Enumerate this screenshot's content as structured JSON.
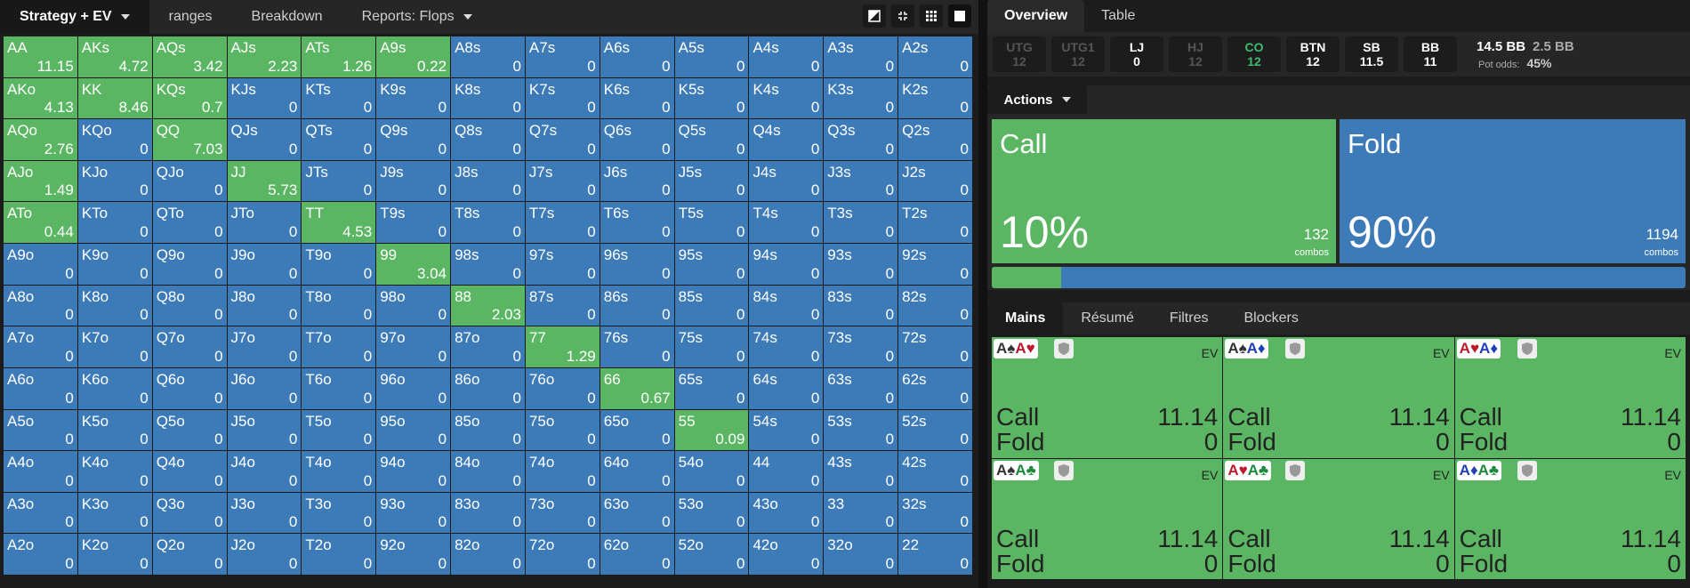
{
  "left_tabs": [
    {
      "label": "Strategy + EV",
      "dropdown": true,
      "active": true
    },
    {
      "label": "ranges"
    },
    {
      "label": "Breakdown"
    },
    {
      "label": "Reports: Flops",
      "dropdown": true
    }
  ],
  "view_buttons": [
    "contrast-icon",
    "compress-icon",
    "grid-icon",
    "square-icon"
  ],
  "grid": [
    [
      [
        "AA",
        "11.15",
        1
      ],
      [
        "AKs",
        "4.72",
        1
      ],
      [
        "AQs",
        "3.42",
        1
      ],
      [
        "AJs",
        "2.23",
        1
      ],
      [
        "ATs",
        "1.26",
        1
      ],
      [
        "A9s",
        "0.22",
        1
      ],
      [
        "A8s",
        "0",
        0
      ],
      [
        "A7s",
        "0",
        0
      ],
      [
        "A6s",
        "0",
        0
      ],
      [
        "A5s",
        "0",
        0
      ],
      [
        "A4s",
        "0",
        0
      ],
      [
        "A3s",
        "0",
        0
      ],
      [
        "A2s",
        "0",
        0
      ]
    ],
    [
      [
        "AKo",
        "4.13",
        1
      ],
      [
        "KK",
        "8.46",
        1
      ],
      [
        "KQs",
        "0.7",
        1
      ],
      [
        "KJs",
        "0",
        0
      ],
      [
        "KTs",
        "0",
        0
      ],
      [
        "K9s",
        "0",
        0
      ],
      [
        "K8s",
        "0",
        0
      ],
      [
        "K7s",
        "0",
        0
      ],
      [
        "K6s",
        "0",
        0
      ],
      [
        "K5s",
        "0",
        0
      ],
      [
        "K4s",
        "0",
        0
      ],
      [
        "K3s",
        "0",
        0
      ],
      [
        "K2s",
        "0",
        0
      ]
    ],
    [
      [
        "AQo",
        "2.76",
        1
      ],
      [
        "KQo",
        "0",
        0
      ],
      [
        "QQ",
        "7.03",
        1
      ],
      [
        "QJs",
        "0",
        0
      ],
      [
        "QTs",
        "0",
        0
      ],
      [
        "Q9s",
        "0",
        0
      ],
      [
        "Q8s",
        "0",
        0
      ],
      [
        "Q7s",
        "0",
        0
      ],
      [
        "Q6s",
        "0",
        0
      ],
      [
        "Q5s",
        "0",
        0
      ],
      [
        "Q4s",
        "0",
        0
      ],
      [
        "Q3s",
        "0",
        0
      ],
      [
        "Q2s",
        "0",
        0
      ]
    ],
    [
      [
        "AJo",
        "1.49",
        1
      ],
      [
        "KJo",
        "0",
        0
      ],
      [
        "QJo",
        "0",
        0
      ],
      [
        "JJ",
        "5.73",
        1
      ],
      [
        "JTs",
        "0",
        0
      ],
      [
        "J9s",
        "0",
        0
      ],
      [
        "J8s",
        "0",
        0
      ],
      [
        "J7s",
        "0",
        0
      ],
      [
        "J6s",
        "0",
        0
      ],
      [
        "J5s",
        "0",
        0
      ],
      [
        "J4s",
        "0",
        0
      ],
      [
        "J3s",
        "0",
        0
      ],
      [
        "J2s",
        "0",
        0
      ]
    ],
    [
      [
        "ATo",
        "0.44",
        1
      ],
      [
        "KTo",
        "0",
        0
      ],
      [
        "QTo",
        "0",
        0
      ],
      [
        "JTo",
        "0",
        0
      ],
      [
        "TT",
        "4.53",
        1
      ],
      [
        "T9s",
        "0",
        0
      ],
      [
        "T8s",
        "0",
        0
      ],
      [
        "T7s",
        "0",
        0
      ],
      [
        "T6s",
        "0",
        0
      ],
      [
        "T5s",
        "0",
        0
      ],
      [
        "T4s",
        "0",
        0
      ],
      [
        "T3s",
        "0",
        0
      ],
      [
        "T2s",
        "0",
        0
      ]
    ],
    [
      [
        "A9o",
        "0",
        0
      ],
      [
        "K9o",
        "0",
        0
      ],
      [
        "Q9o",
        "0",
        0
      ],
      [
        "J9o",
        "0",
        0
      ],
      [
        "T9o",
        "0",
        0
      ],
      [
        "99",
        "3.04",
        1
      ],
      [
        "98s",
        "0",
        0
      ],
      [
        "97s",
        "0",
        0
      ],
      [
        "96s",
        "0",
        0
      ],
      [
        "95s",
        "0",
        0
      ],
      [
        "94s",
        "0",
        0
      ],
      [
        "93s",
        "0",
        0
      ],
      [
        "92s",
        "0",
        0
      ]
    ],
    [
      [
        "A8o",
        "0",
        0
      ],
      [
        "K8o",
        "0",
        0
      ],
      [
        "Q8o",
        "0",
        0
      ],
      [
        "J8o",
        "0",
        0
      ],
      [
        "T8o",
        "0",
        0
      ],
      [
        "98o",
        "0",
        0
      ],
      [
        "88",
        "2.03",
        1
      ],
      [
        "87s",
        "0",
        0
      ],
      [
        "86s",
        "0",
        0
      ],
      [
        "85s",
        "0",
        0
      ],
      [
        "84s",
        "0",
        0
      ],
      [
        "83s",
        "0",
        0
      ],
      [
        "82s",
        "0",
        0
      ]
    ],
    [
      [
        "A7o",
        "0",
        0
      ],
      [
        "K7o",
        "0",
        0
      ],
      [
        "Q7o",
        "0",
        0
      ],
      [
        "J7o",
        "0",
        0
      ],
      [
        "T7o",
        "0",
        0
      ],
      [
        "97o",
        "0",
        0
      ],
      [
        "87o",
        "0",
        0
      ],
      [
        "77",
        "1.29",
        1
      ],
      [
        "76s",
        "0",
        0
      ],
      [
        "75s",
        "0",
        0
      ],
      [
        "74s",
        "0",
        0
      ],
      [
        "73s",
        "0",
        0
      ],
      [
        "72s",
        "0",
        0
      ]
    ],
    [
      [
        "A6o",
        "0",
        0
      ],
      [
        "K6o",
        "0",
        0
      ],
      [
        "Q6o",
        "0",
        0
      ],
      [
        "J6o",
        "0",
        0
      ],
      [
        "T6o",
        "0",
        0
      ],
      [
        "96o",
        "0",
        0
      ],
      [
        "86o",
        "0",
        0
      ],
      [
        "76o",
        "0",
        0
      ],
      [
        "66",
        "0.67",
        1
      ],
      [
        "65s",
        "0",
        0
      ],
      [
        "64s",
        "0",
        0
      ],
      [
        "63s",
        "0",
        0
      ],
      [
        "62s",
        "0",
        0
      ]
    ],
    [
      [
        "A5o",
        "0",
        0
      ],
      [
        "K5o",
        "0",
        0
      ],
      [
        "Q5o",
        "0",
        0
      ],
      [
        "J5o",
        "0",
        0
      ],
      [
        "T5o",
        "0",
        0
      ],
      [
        "95o",
        "0",
        0
      ],
      [
        "85o",
        "0",
        0
      ],
      [
        "75o",
        "0",
        0
      ],
      [
        "65o",
        "0",
        0
      ],
      [
        "55",
        "0.09",
        1
      ],
      [
        "54s",
        "0",
        0
      ],
      [
        "53s",
        "0",
        0
      ],
      [
        "52s",
        "0",
        0
      ]
    ],
    [
      [
        "A4o",
        "0",
        0
      ],
      [
        "K4o",
        "0",
        0
      ],
      [
        "Q4o",
        "0",
        0
      ],
      [
        "J4o",
        "0",
        0
      ],
      [
        "T4o",
        "0",
        0
      ],
      [
        "94o",
        "0",
        0
      ],
      [
        "84o",
        "0",
        0
      ],
      [
        "74o",
        "0",
        0
      ],
      [
        "64o",
        "0",
        0
      ],
      [
        "54o",
        "0",
        0
      ],
      [
        "44",
        "0",
        0
      ],
      [
        "43s",
        "0",
        0
      ],
      [
        "42s",
        "0",
        0
      ]
    ],
    [
      [
        "A3o",
        "0",
        0
      ],
      [
        "K3o",
        "0",
        0
      ],
      [
        "Q3o",
        "0",
        0
      ],
      [
        "J3o",
        "0",
        0
      ],
      [
        "T3o",
        "0",
        0
      ],
      [
        "93o",
        "0",
        0
      ],
      [
        "83o",
        "0",
        0
      ],
      [
        "73o",
        "0",
        0
      ],
      [
        "63o",
        "0",
        0
      ],
      [
        "53o",
        "0",
        0
      ],
      [
        "43o",
        "0",
        0
      ],
      [
        "33",
        "0",
        0
      ],
      [
        "32s",
        "0",
        0
      ]
    ],
    [
      [
        "A2o",
        "0",
        0
      ],
      [
        "K2o",
        "0",
        0
      ],
      [
        "Q2o",
        "0",
        0
      ],
      [
        "J2o",
        "0",
        0
      ],
      [
        "T2o",
        "0",
        0
      ],
      [
        "92o",
        "0",
        0
      ],
      [
        "82o",
        "0",
        0
      ],
      [
        "72o",
        "0",
        0
      ],
      [
        "62o",
        "0",
        0
      ],
      [
        "52o",
        "0",
        0
      ],
      [
        "42o",
        "0",
        0
      ],
      [
        "32o",
        "0",
        0
      ],
      [
        "22",
        "0",
        0
      ]
    ]
  ],
  "right_tabs": [
    {
      "label": "Overview",
      "active": true
    },
    {
      "label": "Table"
    }
  ],
  "positions": [
    {
      "name": "UTG",
      "value": "12",
      "state": "dim"
    },
    {
      "name": "UTG1",
      "value": "12",
      "state": "dim"
    },
    {
      "name": "LJ",
      "value": "0",
      "state": "normal"
    },
    {
      "name": "HJ",
      "value": "12",
      "state": "dim"
    },
    {
      "name": "CO",
      "value": "12",
      "state": "highlight"
    },
    {
      "name": "BTN",
      "value": "12",
      "state": "normal"
    },
    {
      "name": "SB",
      "value": "11.5",
      "state": "normal"
    },
    {
      "name": "BB",
      "value": "11",
      "state": "normal"
    }
  ],
  "pot": {
    "bb": "14.5 BB",
    "bet": "2.5 BB",
    "odds_label": "Pot odds:",
    "odds": "45%"
  },
  "actions_label": "Actions",
  "actions": {
    "call": {
      "name": "Call",
      "pct": "10%",
      "combos": "132",
      "combos_label": "combos",
      "color": "#5bb663"
    },
    "fold": {
      "name": "Fold",
      "pct": "90%",
      "combos": "1194",
      "combos_label": "combos",
      "color": "#3d7ab8"
    }
  },
  "frequency": {
    "call_fraction": 0.1
  },
  "bottom_tabs": [
    {
      "label": "Mains",
      "active": true
    },
    {
      "label": "Résumé"
    },
    {
      "label": "Filtres"
    },
    {
      "label": "Blockers"
    }
  ],
  "combos": [
    {
      "cards": [
        [
          "A",
          "♠",
          "black"
        ],
        [
          "A",
          "♥",
          "red"
        ]
      ],
      "ev_label": "EV",
      "call_label": "Call",
      "call_ev": "11.14",
      "fold_label": "Fold",
      "fold_ev": "0"
    },
    {
      "cards": [
        [
          "A",
          "♠",
          "black"
        ],
        [
          "A",
          "♦",
          "blue"
        ]
      ],
      "ev_label": "EV",
      "call_label": "Call",
      "call_ev": "11.14",
      "fold_label": "Fold",
      "fold_ev": "0"
    },
    {
      "cards": [
        [
          "A",
          "♥",
          "red"
        ],
        [
          "A",
          "♦",
          "blue"
        ]
      ],
      "ev_label": "EV",
      "call_label": "Call",
      "call_ev": "11.14",
      "fold_label": "Fold",
      "fold_ev": "0"
    },
    {
      "cards": [
        [
          "A",
          "♠",
          "black"
        ],
        [
          "A",
          "♣",
          "green"
        ]
      ],
      "ev_label": "EV",
      "call_label": "Call",
      "call_ev": "11.14",
      "fold_label": "Fold",
      "fold_ev": "0"
    },
    {
      "cards": [
        [
          "A",
          "♥",
          "red"
        ],
        [
          "A",
          "♣",
          "green"
        ]
      ],
      "ev_label": "EV",
      "call_label": "Call",
      "call_ev": "11.14",
      "fold_label": "Fold",
      "fold_ev": "0"
    },
    {
      "cards": [
        [
          "A",
          "♦",
          "blue"
        ],
        [
          "A",
          "♣",
          "green"
        ]
      ],
      "ev_label": "EV",
      "call_label": "Call",
      "call_ev": "11.14",
      "fold_label": "Fold",
      "fold_ev": "0"
    }
  ]
}
